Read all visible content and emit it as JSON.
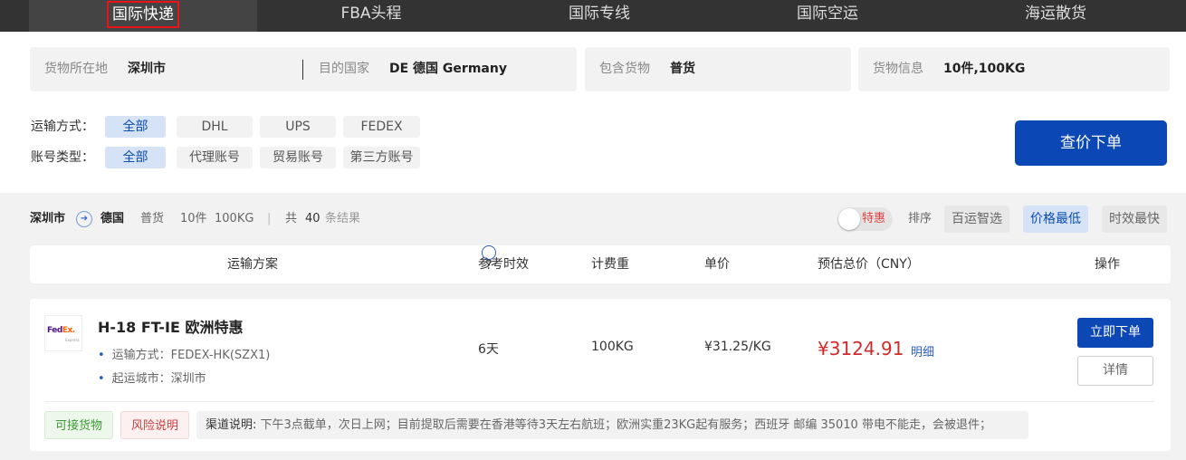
{
  "nav": {
    "tabs": [
      {
        "label": "国际快递",
        "active": true
      },
      {
        "label": "FBA头程",
        "active": false
      },
      {
        "label": "国际专线",
        "active": false
      },
      {
        "label": "国际空运",
        "active": false
      },
      {
        "label": "海运散货",
        "active": false
      }
    ]
  },
  "search": {
    "origin_label": "货物所在地",
    "origin_value": "深圳市",
    "dest_label": "目的国家",
    "dest_value": "DE 德国 Germany",
    "cargo_label": "包含货物",
    "cargo_value": "普货",
    "info_label": "货物信息",
    "info_value": "10件,100KG",
    "transport_label": "运输方式：",
    "transport_options": [
      "全部",
      "DHL",
      "UPS",
      "FEDEX"
    ],
    "account_label": "账号类型：",
    "account_options": [
      "全部",
      "代理账号",
      "贸易账号",
      "第三方账号"
    ],
    "submit_label": "查价下单"
  },
  "summary": {
    "origin": "深圳市",
    "arrow": "➜",
    "dest": "德国",
    "cargo": "普货",
    "pieces": "10件",
    "weight": "100KG",
    "sep": "|",
    "total_prefix": "共",
    "total_count": "40",
    "total_suffix": "条结果",
    "special_label": "特惠",
    "sort_label": "排序",
    "sort_options": [
      "百运智选",
      "价格最低",
      "时效最快"
    ]
  },
  "table_header": {
    "plan": "运输方案",
    "time": "参考时效",
    "weight": "计费重",
    "unit_price": "单价",
    "total": "预估总价（CNY）",
    "action": "操作"
  },
  "result": {
    "carrier_logo": "FedEx",
    "carrier_logo_main": "Fed",
    "carrier_logo_ex": "Ex.",
    "carrier_logo_sub": "Express",
    "title": "H-18 FT-IE 欧洲特惠",
    "transport": "运输方式：FEDEX-HK(SZX1)",
    "start_city": "起运城市：深圳市",
    "time": "6天",
    "weight": "100KG",
    "unit_price": "¥31.25/KG",
    "total_price": "¥3124.91",
    "detail_link": "明细",
    "order_button": "立即下单",
    "details_button": "详情",
    "tag_accept": "可接货物",
    "tag_risk": "风险说明",
    "channel_label": "渠道说明:",
    "channel_text": " 下午3点截单，次日上网；目前提取后需要在香港等待3天左右航班；欧洲实重23KG起有服务；西班牙 邮编 35010 带电不能走，会被退件；"
  },
  "colors": {
    "primary": "#0b47b5",
    "price_red": "#d02b2b",
    "nav_bg": "#333333",
    "highlight_border": "#e8141a"
  }
}
